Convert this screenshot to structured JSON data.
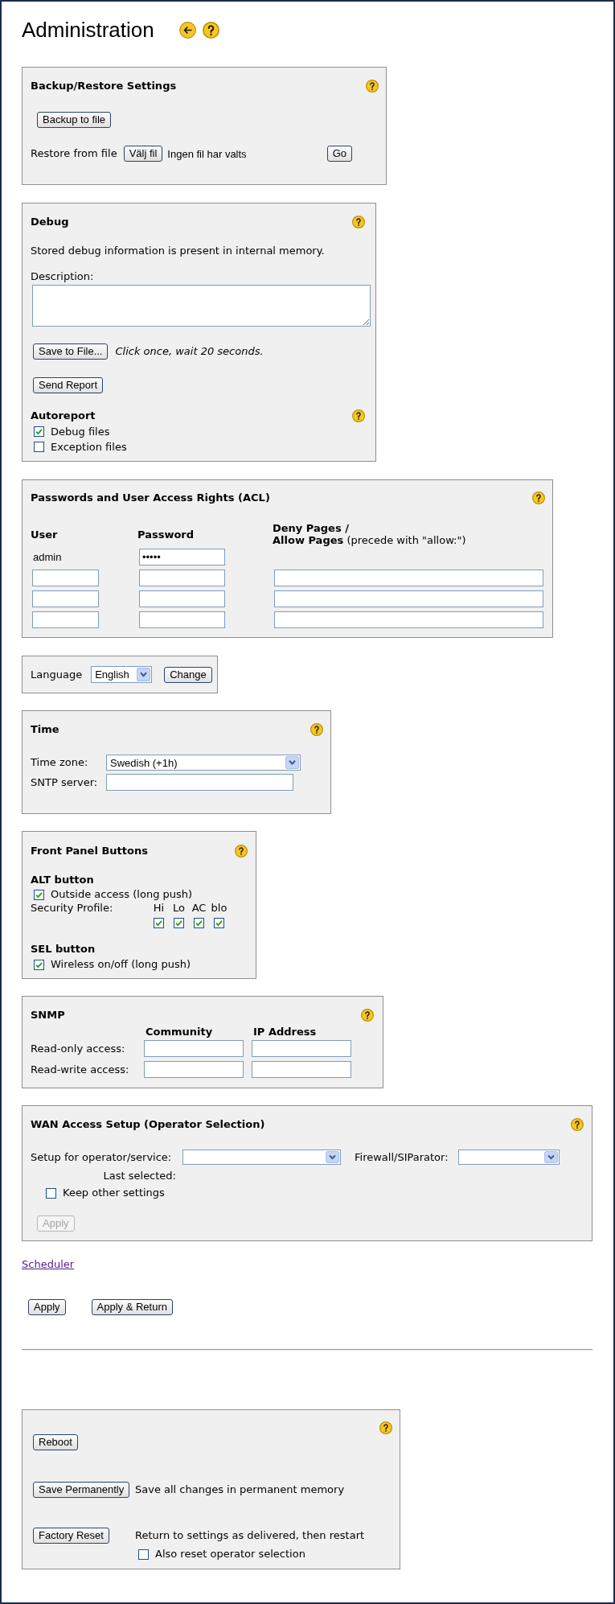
{
  "page": {
    "title": "Administration"
  },
  "backup": {
    "title": "Backup/Restore Settings",
    "backup_button": "Backup to file",
    "restore_label": "Restore from file",
    "choose_file_button": "Välj fil",
    "file_status": "Ingen fil har valts",
    "go_button": "Go"
  },
  "debug": {
    "title": "Debug",
    "info": "Stored debug information is present in internal memory.",
    "description_label": "Description:",
    "save_button": "Save to File...",
    "save_hint": "Click once, wait 20 seconds.",
    "send_button": "Send Report",
    "autoreport": {
      "title": "Autoreport",
      "options": [
        {
          "label": "Debug files",
          "checked": true
        },
        {
          "label": "Exception files",
          "checked": false
        }
      ]
    }
  },
  "passwords": {
    "title": "Passwords and User Access Rights (ACL)",
    "columns": [
      "User",
      "Password"
    ],
    "pages_heading": [
      "**Deny Pages /**",
      "**Allow Pages** (precede with \"allow:\")"
    ],
    "rows": [
      {
        "kind": "existing",
        "user": "admin",
        "password": "•••••"
      },
      {
        "kind": "new"
      },
      {
        "kind": "new"
      },
      {
        "kind": "new"
      }
    ]
  },
  "language": {
    "label": "Language",
    "value": "English",
    "button": "Change"
  },
  "time": {
    "title": "Time",
    "time_zone_label": "Time zone:",
    "time_zone": "Swedish (+1h)",
    "sntp_label": "SNTP server:"
  },
  "front_panel": {
    "title": "Front Panel Buttons",
    "alt_button": {
      "title": "ALT button",
      "outside_access": {
        "label": "Outside access (long push)",
        "checked": true
      },
      "profile_label": "Security Profile:",
      "profiles": [
        {
          "label": "Hi",
          "checked": true
        },
        {
          "label": "Lo",
          "checked": true
        },
        {
          "label": "AC",
          "checked": true
        },
        {
          "label": "blo",
          "checked": true
        }
      ]
    },
    "sel_button": {
      "title": "SEL button",
      "wireless": {
        "label": "Wireless on/off (long push)",
        "checked": true
      }
    }
  },
  "snmp": {
    "title": "SNMP",
    "columns": [
      "Community",
      "IP Address"
    ],
    "rows": [
      "Read-only access:",
      "Read-write access:"
    ]
  },
  "wan": {
    "title": "WAN Access Setup (Operator Selection)",
    "operator_label": "Setup for operator/service:",
    "firewall_label": "Firewall/SIParator:",
    "last_selected_label": "Last selected:",
    "keep_settings": {
      "label": "Keep other settings",
      "checked": false
    },
    "apply": {
      "label": "Apply",
      "disabled": true
    }
  },
  "scheduler_link": "Scheduler",
  "actions": [
    "Apply",
    "Apply & Return"
  ],
  "maintenance": {
    "reboot_button": "Reboot",
    "save_button": "Save Permanently",
    "save_hint": "Save all changes in permanent memory",
    "factory_button": "Factory Reset",
    "factory_hint": "Return to settings as delivered, then restart",
    "reset_operator": {
      "label": "Also reset operator selection",
      "checked": false
    }
  }
}
